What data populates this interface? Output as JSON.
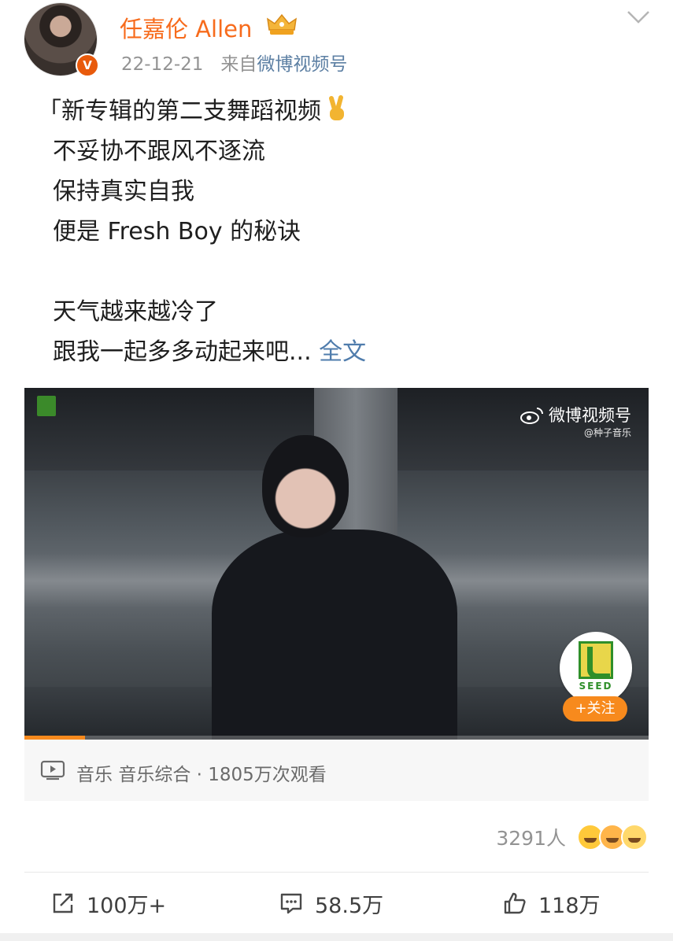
{
  "user": {
    "name": "任嘉伦 Allen",
    "badge_icon": "crown-badge-icon",
    "verified_icon": "verified-v-icon",
    "verified_letter": "V",
    "date": "22-12-21",
    "source_prefix": "来自",
    "source": "微博视频号"
  },
  "post": {
    "lines": [
      "「新专辑的第二支舞蹈视频",
      "不妥协不跟风不逐流",
      "保持真实自我",
      "便是 Fresh Boy 的秘诀",
      "天气越来越冷了",
      "跟我一起多多动起来吧... "
    ],
    "full_text_link": "全文"
  },
  "video": {
    "watermark_brand": "微博视频号",
    "watermark_handle": "@种子音乐",
    "seed_label": "SEED",
    "follow_label": "+关注",
    "progress_fraction": 0.097
  },
  "video_info": {
    "category": "音乐",
    "subcategory": "音乐综合",
    "separator": "·",
    "views": "1805万次观看"
  },
  "reactions": {
    "count": "3291人"
  },
  "actions": {
    "share": "100万+",
    "comment": "58.5万",
    "like": "118万"
  },
  "colors": {
    "username": "#f76b1c",
    "link": "#4f7cac",
    "verified": "#e85a0c",
    "follow": "#f78a1d"
  }
}
